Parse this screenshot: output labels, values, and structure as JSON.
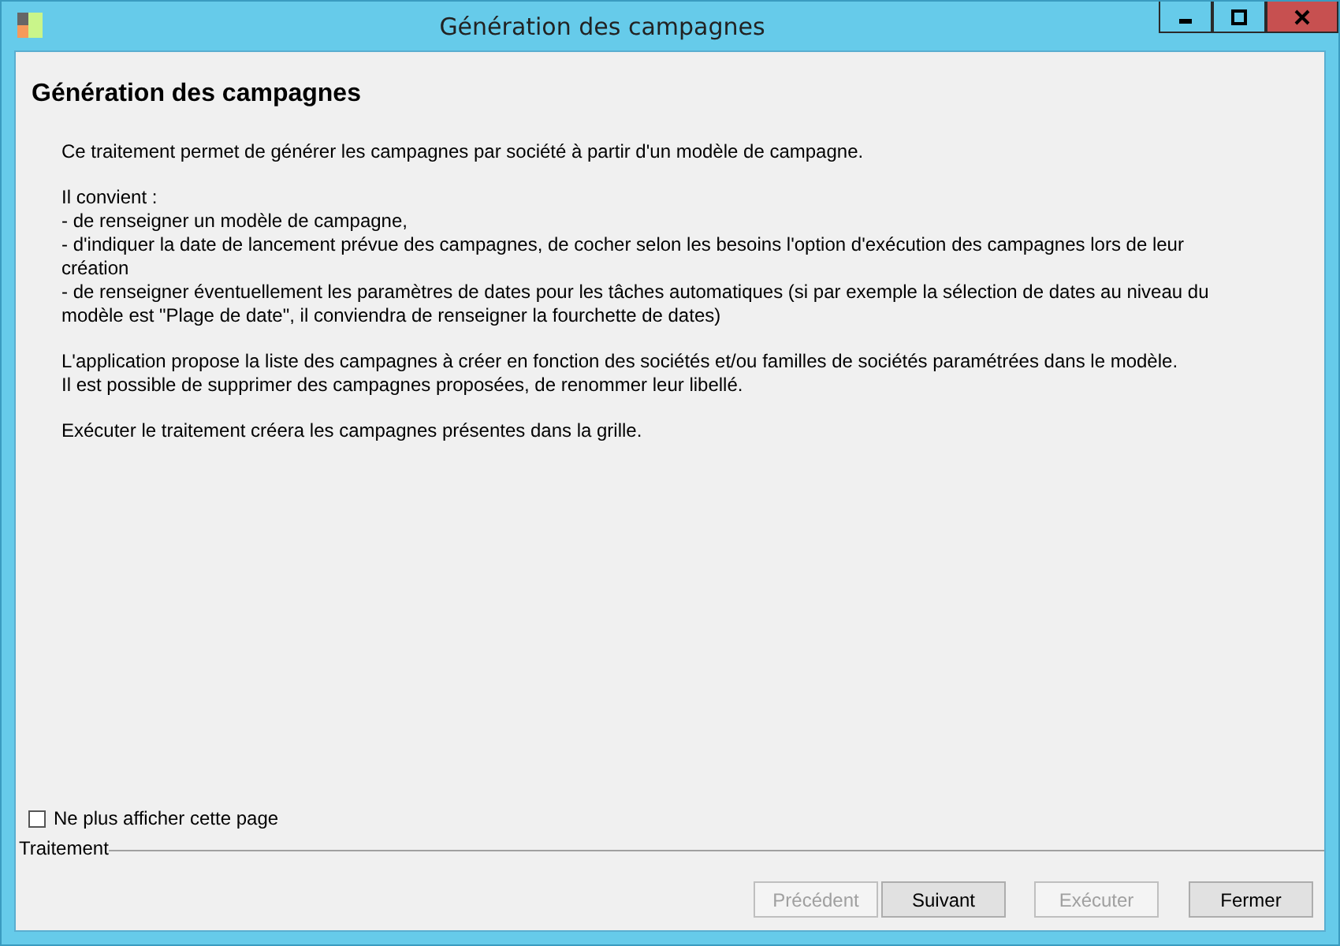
{
  "window": {
    "title": "Génération des campagnes"
  },
  "heading": "Génération des campagnes",
  "paragraphs": [
    [
      "Ce traitement permet de générer les campagnes par société à partir d'un modèle de campagne."
    ],
    [
      "Il convient :",
      "- de renseigner un modèle de campagne,",
      "- d'indiquer la date de lancement prévue des campagnes, de cocher selon les besoins l'option d'exécution des campagnes lors de leur création",
      "- de renseigner éventuellement les paramètres de dates pour les tâches automatiques (si par exemple la sélection de dates au niveau du modèle est \"Plage de date\", il conviendra de renseigner la fourchette de dates)"
    ],
    [
      "L'application propose la liste des campagnes à créer en fonction des sociétés et/ou familles de sociétés paramétrées dans le modèle.",
      "Il est possible de supprimer des campagnes proposées, de renommer leur libellé."
    ],
    [
      "Exécuter le traitement créera les campagnes présentes dans la grille."
    ]
  ],
  "checkbox": {
    "label": "Ne plus afficher cette page",
    "checked": false
  },
  "group_label": "Traitement",
  "buttons": [
    {
      "label": "Précédent",
      "disabled": true
    },
    {
      "label": "Suivant",
      "disabled": false
    },
    {
      "label": "Exécuter",
      "disabled": true
    },
    {
      "label": "Fermer",
      "disabled": false
    }
  ]
}
